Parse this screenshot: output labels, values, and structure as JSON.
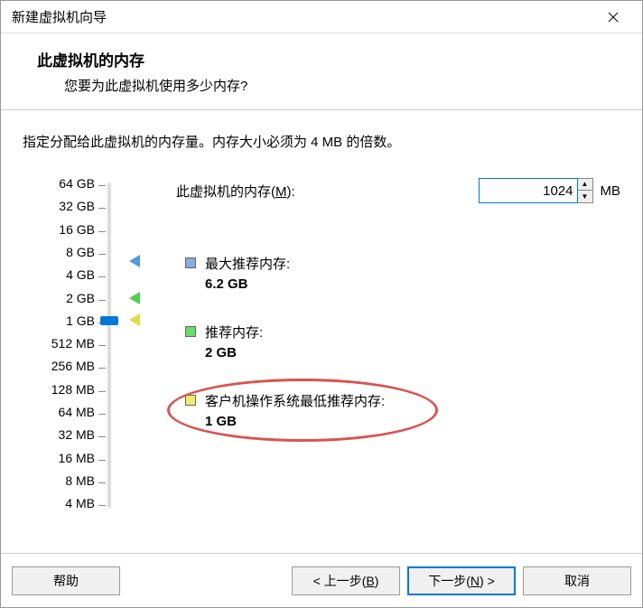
{
  "window": {
    "title": "新建虚拟机向导"
  },
  "header": {
    "title": "此虚拟机的内存",
    "subtitle": "您要为此虚拟机使用多少内存?"
  },
  "instruction": "指定分配给此虚拟机的内存量。内存大小必须为 4 MB 的倍数。",
  "memory": {
    "label_prefix": "此虚拟机的内存(",
    "label_accel": "M",
    "label_suffix": "):",
    "value": "1024",
    "unit": "MB"
  },
  "ticks": [
    "64 GB",
    "32 GB",
    "16 GB",
    "8 GB",
    "4 GB",
    "2 GB",
    "1 GB",
    "512 MB",
    "256 MB",
    "128 MB",
    "64 MB",
    "32 MB",
    "16 MB",
    "8 MB",
    "4 MB"
  ],
  "legend": {
    "max": {
      "label": "最大推荐内存:",
      "value": "6.2 GB"
    },
    "rec": {
      "label": "推荐内存:",
      "value": "2 GB"
    },
    "min": {
      "label": "客户机操作系统最低推荐内存:",
      "value": "1 GB"
    }
  },
  "buttons": {
    "help": "帮助",
    "back_prefix": "< 上一步(",
    "back_accel": "B",
    "back_suffix": ")",
    "next_prefix": "下一步(",
    "next_accel": "N",
    "next_suffix": ") >",
    "cancel": "取消"
  }
}
